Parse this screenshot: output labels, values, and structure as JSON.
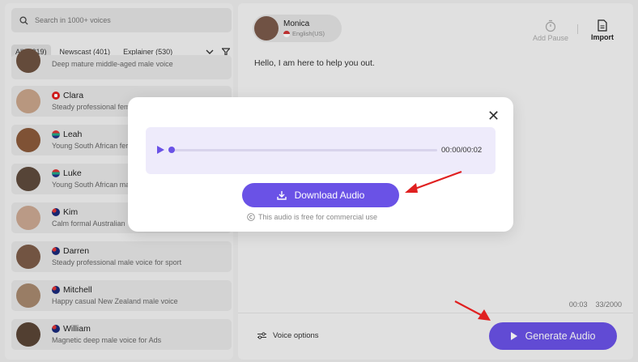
{
  "search": {
    "placeholder": "Search in 1000+ voices"
  },
  "filters": {
    "chips": [
      {
        "label": "All (1219)",
        "active": true
      },
      {
        "label": "Newscast (401)",
        "active": false
      },
      {
        "label": "Explainer (530)",
        "active": false
      }
    ],
    "icons": [
      "chevron-down-icon",
      "filter-icon"
    ]
  },
  "voices": [
    {
      "name": "",
      "desc": "Deep mature middle-aged male voice",
      "flag": ""
    },
    {
      "name": "Clara",
      "desc": "Steady professional fem",
      "flag": "canada"
    },
    {
      "name": "Leah",
      "desc": "Young South African fer",
      "flag": "south-africa"
    },
    {
      "name": "Luke",
      "desc": "Young South African ma",
      "flag": "south-africa"
    },
    {
      "name": "Kim",
      "desc": "Calm formal Australian",
      "flag": "australia"
    },
    {
      "name": "Darren",
      "desc": "Steady professional male voice for sport",
      "flag": "australia"
    },
    {
      "name": "Mitchell",
      "desc": "Happy casual New Zealand male voice",
      "flag": "new-zealand"
    },
    {
      "name": "William",
      "desc": "Magnetic deep male voice for Ads",
      "flag": "australia"
    }
  ],
  "speaker": {
    "name": "Monica",
    "lang": "English(US)"
  },
  "toolbar": {
    "add_pause": "Add Pause",
    "import": "Import"
  },
  "editor": {
    "text": "Hello, I am here to help you out."
  },
  "counter": {
    "time": "00:03",
    "chars": "33/2000"
  },
  "footer": {
    "voice_options": "Voice options",
    "generate": "Generate Audio"
  },
  "modal": {
    "time": "00:00/00:02",
    "download": "Download Audio",
    "note": "This audio is free for commercial use"
  },
  "colors": {
    "accent": "#6a52e6",
    "arrow": "#e02020"
  }
}
